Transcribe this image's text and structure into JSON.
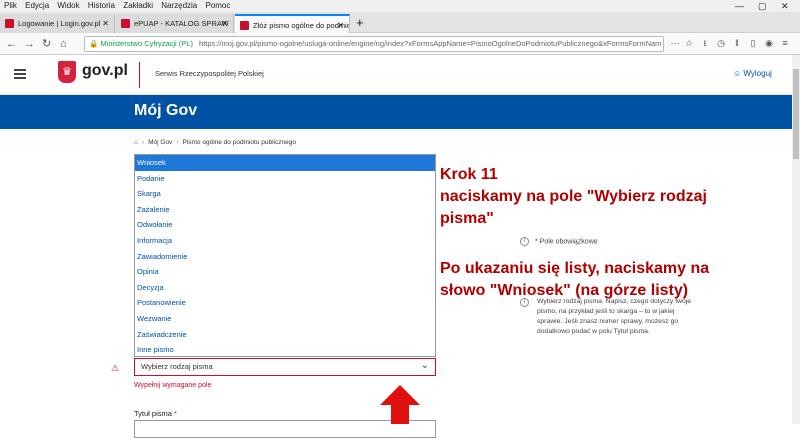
{
  "browser": {
    "menu": [
      "Plik",
      "Edycja",
      "Widok",
      "Historia",
      "Zakładki",
      "Narzędzia",
      "Pomoc"
    ],
    "window_controls": [
      "—",
      "▢",
      "✕"
    ],
    "tabs": [
      {
        "title": "Logowanie | Login.gov.pl",
        "active": false
      },
      {
        "title": "ePUAP - KATALOG SPRAW",
        "active": false
      },
      {
        "title": "Złóż pismo ogólne do podmiotu",
        "active": true
      }
    ],
    "new_tab": "+",
    "secure_label": "Ministerstwo Cyfryzacji (PL)",
    "url": "https://moj.gov.pl/pismo-ogolne/usluga-online/engine/ng/index?xFormsAppName=PismoOgolneDoPodmiotuPublicznego&xFormsFormNam",
    "colors": {
      "tab_accent": "#0a84ff",
      "secure": "#12a04a"
    }
  },
  "header": {
    "brand": "gov.pl",
    "service": "Serwis Rzeczypospolitej Polskiej",
    "logout": "Wyloguj",
    "logout_icon": "user-circle-icon"
  },
  "band": {
    "title": "Mój Gov",
    "color": "#0052a5"
  },
  "breadcrumb": {
    "home_icon": "home-icon",
    "items": [
      "Mój Gov",
      "Pismo ogólne do podmiotu publicznego"
    ]
  },
  "form": {
    "options": [
      "Wniosek",
      "Podanie",
      "Skarga",
      "Zażalenie",
      "Odwołanie",
      "Informacja",
      "Zawiadomienie",
      "Opinia",
      "Decyzja",
      "Postanowienie",
      "Wezwanie",
      "Zaświadczenie",
      "Inne pismo"
    ],
    "highlighted_option": "Wniosek",
    "select_value": "Wybierz rodzaj pisma",
    "error": "Wypełnij wymagane pole",
    "title_label": "Tytuł pisma",
    "required_mark": "*",
    "required_note": "* Pole obowiązkowe",
    "help_text": "Wybierz rodzaj pisma. Napisz, czego dotyczy twoje pismo, na przykład jeśli to skarga – to w jakiej sprawie. Jeśli znasz numer sprawy, możesz go dodatkowo podać w polu Tytuł pisma."
  },
  "annotation": {
    "lines_top": [
      "Krok 11",
      "naciskamy na pole \"Wybierz rodzaj",
      "pisma\""
    ],
    "lines_bottom": [
      "Po ukazaniu się listy, naciskamy na",
      "słowo \"Wniosek\" (na górze listy)"
    ],
    "color": "#b00000",
    "arrow_color": "#e01010"
  }
}
